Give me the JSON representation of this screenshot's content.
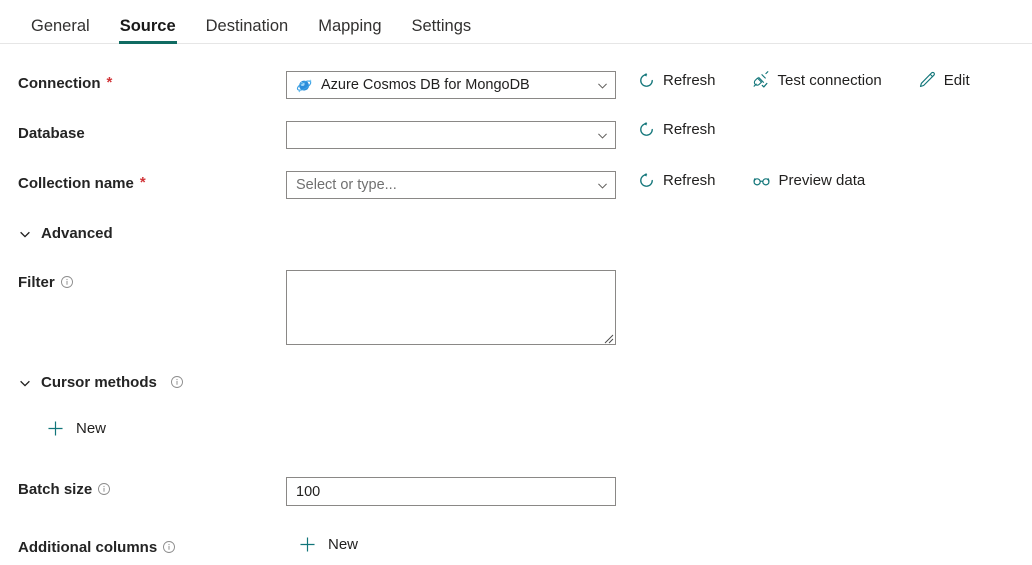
{
  "tabs": [
    {
      "label": "General",
      "active": false
    },
    {
      "label": "Source",
      "active": true
    },
    {
      "label": "Destination",
      "active": false
    },
    {
      "label": "Mapping",
      "active": false
    },
    {
      "label": "Settings",
      "active": false
    }
  ],
  "form": {
    "connection": {
      "label": "Connection",
      "required": true,
      "value": "Azure Cosmos DB for MongoDB",
      "icon": "azure-cosmos-db-icon",
      "actions": [
        {
          "label": "Refresh",
          "icon": "refresh-icon"
        },
        {
          "label": "Test connection",
          "icon": "plug-check-icon"
        },
        {
          "label": "Edit",
          "icon": "pencil-icon"
        }
      ]
    },
    "database": {
      "label": "Database",
      "required": false,
      "value": "",
      "placeholder": "",
      "actions": [
        {
          "label": "Refresh",
          "icon": "refresh-icon"
        }
      ]
    },
    "collection": {
      "label": "Collection name",
      "required": true,
      "value": "",
      "placeholder": "Select or type...",
      "actions": [
        {
          "label": "Refresh",
          "icon": "refresh-icon"
        },
        {
          "label": "Preview data",
          "icon": "glasses-icon"
        }
      ]
    },
    "advanced_section": {
      "label": "Advanced",
      "expanded": true,
      "chevron": "chevron-down-icon"
    },
    "filter": {
      "label": "Filter",
      "info": "info-icon",
      "value": ""
    },
    "cursor_section": {
      "label": "Cursor methods",
      "expanded": true,
      "chevron": "chevron-down-icon",
      "info": "info-icon",
      "new_label": "New",
      "new_icon": "plus-icon"
    },
    "batch_size": {
      "label": "Batch size",
      "info": "info-icon",
      "value": "100"
    },
    "additional_columns": {
      "label": "Additional columns",
      "info": "info-icon",
      "new_label": "New",
      "new_icon": "plus-icon"
    }
  },
  "colors": {
    "accent_teal": "#106b62",
    "icon_teal": "#13767a",
    "required_red": "#d13438",
    "border_gray": "#8a8886",
    "placeholder_gray": "#707070"
  }
}
